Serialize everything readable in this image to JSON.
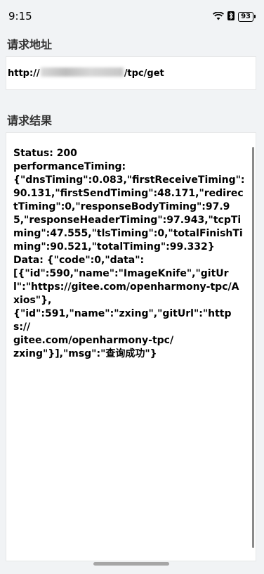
{
  "status_bar": {
    "time": "9:15",
    "battery": "93",
    "icons": [
      "wifi-icon",
      "bluetooth-icon",
      "battery-icon"
    ]
  },
  "request": {
    "title": "请求地址",
    "url_prefix": "http://",
    "url_suffix": "/tpc/get"
  },
  "result": {
    "title": "请求结果",
    "text": "Status: 200\nperformanceTiming:\n{\"dnsTiming\":0.083,\"firstReceiveTiming\":90.131,\"firstSendTiming\":48.171,\"redirectTiming\":0,\"responseBodyTiming\":97.95,\"responseHeaderTiming\":97.943,\"tcpTiming\":47.555,\"tlsTiming\":0,\"totalFinishTiming\":90.521,\"totalTiming\":99.332}\nData: {\"code\":0,\"data\":\n[{\"id\":590,\"name\":\"ImageKnife\",\"gitUrl\":\"https://gitee.com/openharmony-tpc/Axios\"},\n{\"id\":591,\"name\":\"zxing\",\"gitUrl\":\"https://\ngitee.com/openharmony-tpc/\nzxing\"}],\"msg\":\"查询成功\"}"
  }
}
